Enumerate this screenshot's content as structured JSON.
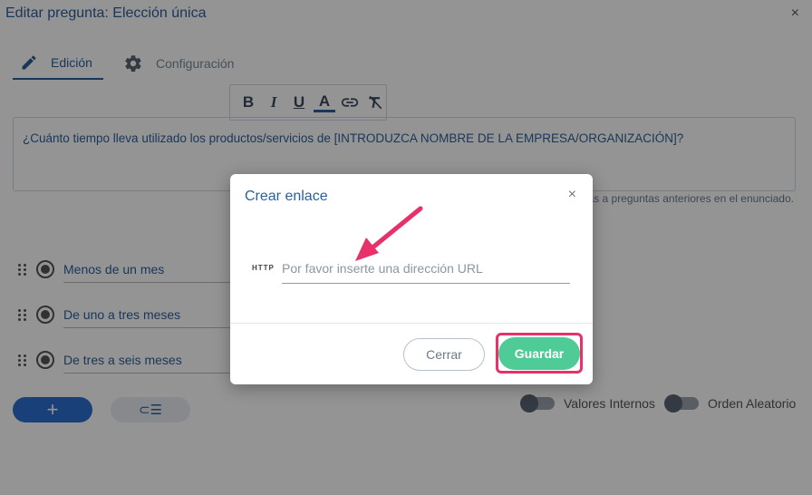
{
  "window": {
    "title": "Editar pregunta: Elección única",
    "close_glyph": "×"
  },
  "tabs": [
    {
      "label": "Edición",
      "icon": "pencil-icon",
      "active": true
    },
    {
      "label": "Configuración",
      "icon": "gear-icon",
      "active": false
    }
  ],
  "format_toolbar": {
    "bold": "B",
    "italic": "I",
    "underline": "U",
    "text_color": "A"
  },
  "question": {
    "text": "¿Cuánto tiempo lleva utilizado los productos/servicios de [INTRODUZCA NOMBRE DE LA EMPRESA/ORGANIZACIÓN]?",
    "hint": "as a preguntas anteriores en el enunciado."
  },
  "options": [
    {
      "label": "Menos de un mes"
    },
    {
      "label": "De uno a tres meses"
    },
    {
      "label": "De tres a seis meses"
    }
  ],
  "actions": {
    "add_glyph": "+",
    "list_glyph": "⊂☰"
  },
  "toggles": {
    "internal_values": "Valores Internos",
    "random_order": "Orden Aleatorio"
  },
  "modal": {
    "title": "Crear enlace",
    "close_glyph": "×",
    "prefix_label": "HTTP",
    "url_placeholder": "Por favor inserte una dirección URL",
    "url_value": "",
    "cancel_label": "Cerrar",
    "save_label": "Guardar"
  },
  "colors": {
    "accent": "#2d5f9a",
    "save": "#4ecb96",
    "highlight": "#e8306a",
    "add_button": "#2d6fd1"
  }
}
